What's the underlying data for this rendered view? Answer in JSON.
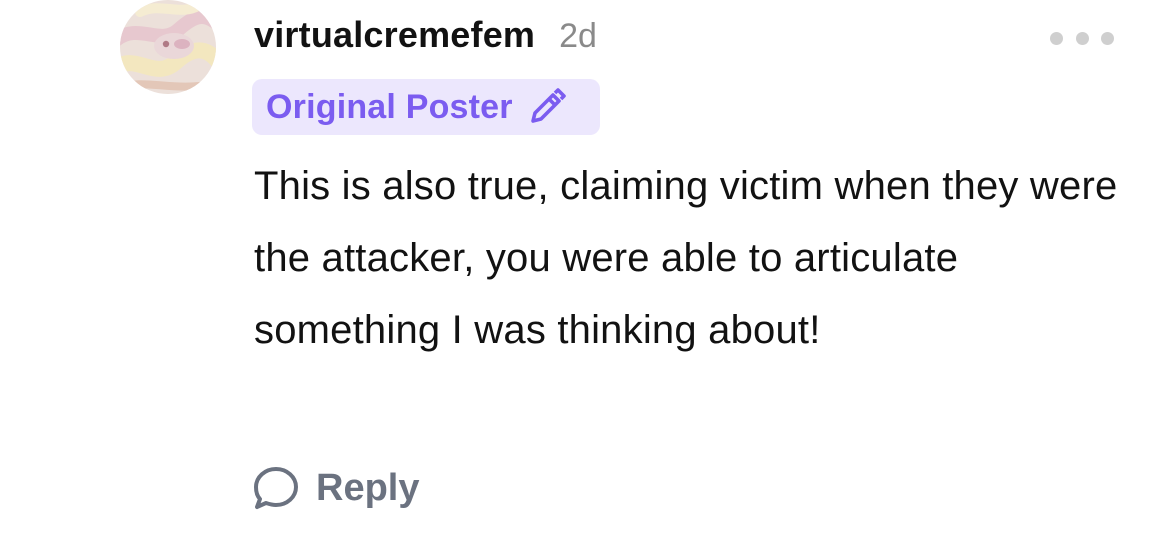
{
  "comment": {
    "avatar": {
      "icon": "snake-avatar-icon",
      "colors": [
        "#e9d9d4",
        "#f2e6b8",
        "#d9b7c4"
      ]
    },
    "author": "virtualcremefem",
    "timestamp": "2d",
    "more_menu_icon": "more-dots-icon",
    "badge": {
      "label": "Original Poster",
      "icon": "pencil-icon",
      "background": "#ece7fd",
      "color": "#7b5cf0"
    },
    "text": "This is also true, claiming victim when they were the attacker, you were able to articulate something I was thinking about!",
    "actions": {
      "reply_label": "Reply",
      "reply_icon": "speech-bubble-icon"
    }
  }
}
